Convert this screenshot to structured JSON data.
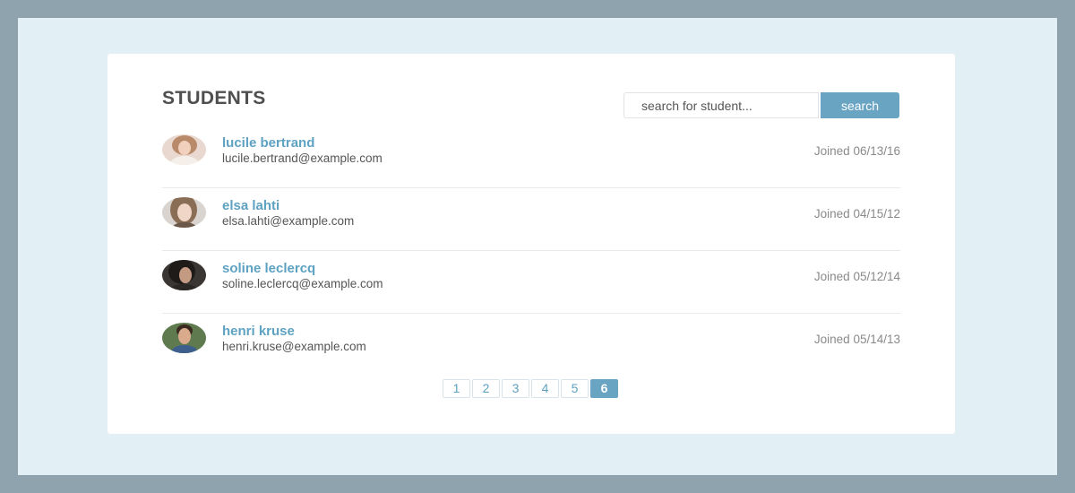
{
  "header": {
    "title": "STUDENTS"
  },
  "search": {
    "placeholder": "search for student...",
    "button_label": "search"
  },
  "students": [
    {
      "name": "lucile bertrand",
      "email": "lucile.bertrand@example.com",
      "joined": "Joined 06/13/16"
    },
    {
      "name": "elsa lahti",
      "email": "elsa.lahti@example.com",
      "joined": "Joined 04/15/12"
    },
    {
      "name": "soline leclercq",
      "email": "soline.leclercq@example.com",
      "joined": "Joined 05/12/14"
    },
    {
      "name": "henri kruse",
      "email": "henri.kruse@example.com",
      "joined": "Joined 05/14/13"
    }
  ],
  "pagination": {
    "pages": [
      "1",
      "2",
      "3",
      "4",
      "5",
      "6"
    ],
    "current": "6"
  },
  "colors": {
    "accent": "#6aa4c3",
    "link": "#5ea2c2",
    "outer_frame": "#8fa3ae",
    "background": "#e2f0f6",
    "card": "#ffffff"
  }
}
